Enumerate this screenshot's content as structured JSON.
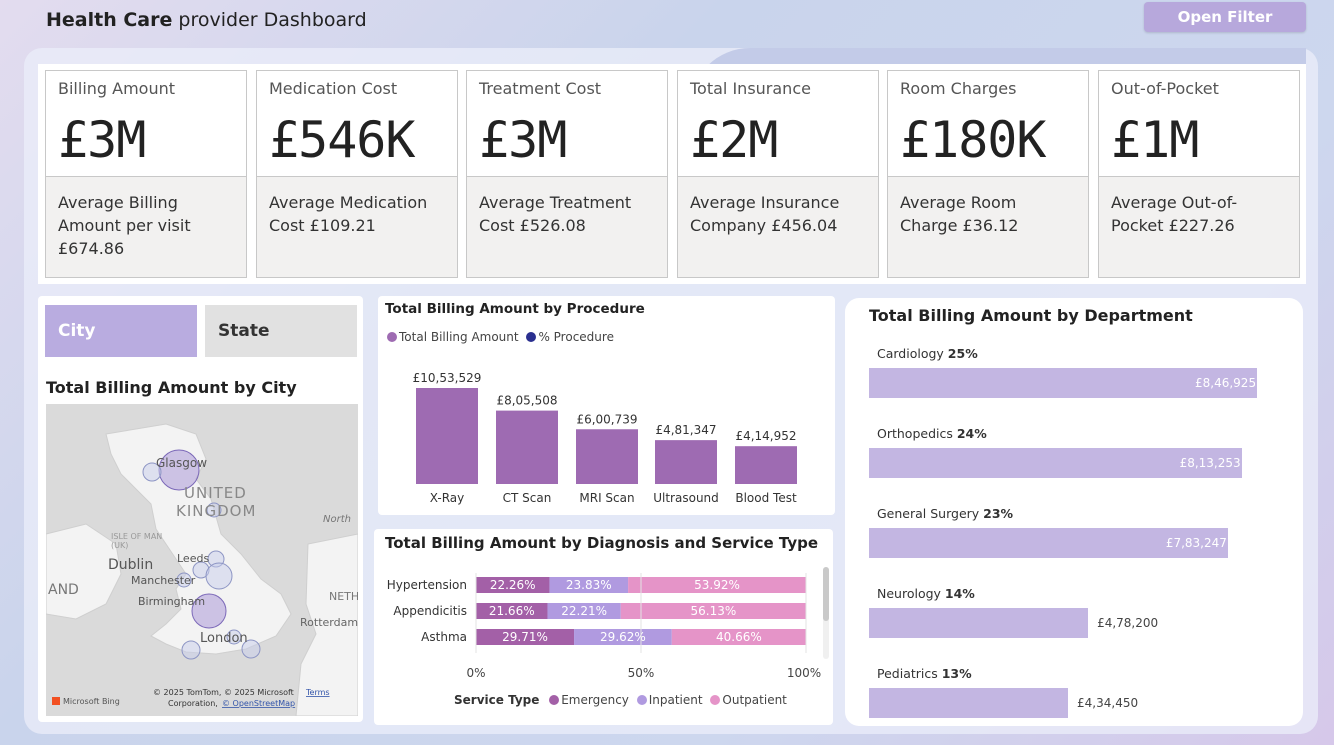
{
  "header": {
    "title_bold": "Health Care",
    "title_rest": " provider Dashboard",
    "open_filter": "Open Filter"
  },
  "kpis": [
    {
      "label": "Billing Amount",
      "value": "£3M",
      "sub": "Average Billing Amount per visit £674.86"
    },
    {
      "label": "Medication Cost",
      "value": "£546K",
      "sub": "Average Medication Cost £109.21"
    },
    {
      "label": "Treatment Cost",
      "value": "£3M",
      "sub": "Average Treatment Cost £526.08"
    },
    {
      "label": "Total Insurance",
      "value": "£2M",
      "sub": "Average Insurance Company £456.04"
    },
    {
      "label": "Room Charges",
      "value": "£180K",
      "sub": "Average Room Charge £36.12"
    },
    {
      "label": "Out-of-Pocket",
      "value": "£1M",
      "sub": "Average Out-of-Pocket £227.26"
    }
  ],
  "map_panel": {
    "toggle_city": "City",
    "toggle_state": "State",
    "title": "Total Billing Amount by City",
    "labels": {
      "glasgow": "Glasgow",
      "uk1": "UNITED",
      "uk2": "KINGDOM",
      "north": "North",
      "isle": "ISLE OF MAN",
      "uk_abbr": "(UK)",
      "dublin": "Dublin",
      "leeds": "Leeds",
      "manchester": "Manchester",
      "and": "AND",
      "birmingham": "Birmingham",
      "neth": "NETH",
      "rotterdam": "Rotterdam",
      "london": "London"
    },
    "bing": "Microsoft Bing",
    "copyright1": "© 2025 TomTom, © 2025 Microsoft",
    "terms": "Terms",
    "copyright2": "Corporation,",
    "osm": "© OpenStreetMap"
  },
  "chart_data": [
    {
      "type": "bar",
      "title": "Total Billing Amount by Procedure",
      "legend": [
        "Total Billing Amount",
        "% Procedure"
      ],
      "categories": [
        "X-Ray",
        "CT Scan",
        "MRI Scan",
        "Ultrasound",
        "Blood Test"
      ],
      "values": [
        1053529,
        805508,
        600739,
        481347,
        414952
      ],
      "value_labels": [
        "£10,53,529",
        "£8,05,508",
        "£6,00,739",
        "£4,81,347",
        "£4,14,952"
      ],
      "colors": {
        "bar": "#9e6bb2",
        "total_billing_dot": "#9e6bb2",
        "percent_procedure_dot": "#2a2f8f"
      }
    },
    {
      "type": "bar",
      "title": "Total Billing Amount by Diagnosis and Service Type",
      "categories": [
        "Hypertension",
        "Appendicitis",
        "Asthma"
      ],
      "series": [
        {
          "name": "Emergency",
          "values": [
            22.26,
            21.66,
            29.71
          ],
          "labels": [
            "22.26%",
            "21.66%",
            "29.71%"
          ],
          "color": "#a360a7"
        },
        {
          "name": "Inpatient",
          "values": [
            23.83,
            22.21,
            29.62
          ],
          "labels": [
            "23.83%",
            "22.21%",
            "29.62%"
          ],
          "color": "#b09ae0"
        },
        {
          "name": "Outpatient",
          "values": [
            53.92,
            56.13,
            40.66
          ],
          "labels": [
            "53.92%",
            "56.13%",
            "40.66%"
          ],
          "color": "#e594c8"
        }
      ],
      "xticks": [
        "0%",
        "50%",
        "100%"
      ],
      "legend_title": "Service Type"
    },
    {
      "type": "bar",
      "title": "Total Billing Amount by Department",
      "categories": [
        "Cardiology",
        "Orthopedics",
        "General Surgery",
        "Neurology",
        "Pediatrics"
      ],
      "values": [
        846925,
        813253,
        783247,
        478200,
        434450
      ],
      "value_labels": [
        "£8,46,925",
        "£8,13,253",
        "£7,83,247",
        "£4,78,200",
        "£4,34,450"
      ],
      "percent_labels": [
        "25%",
        "24%",
        "23%",
        "14%",
        "13%"
      ],
      "colors": {
        "bar": "#c3b6e2"
      }
    }
  ]
}
